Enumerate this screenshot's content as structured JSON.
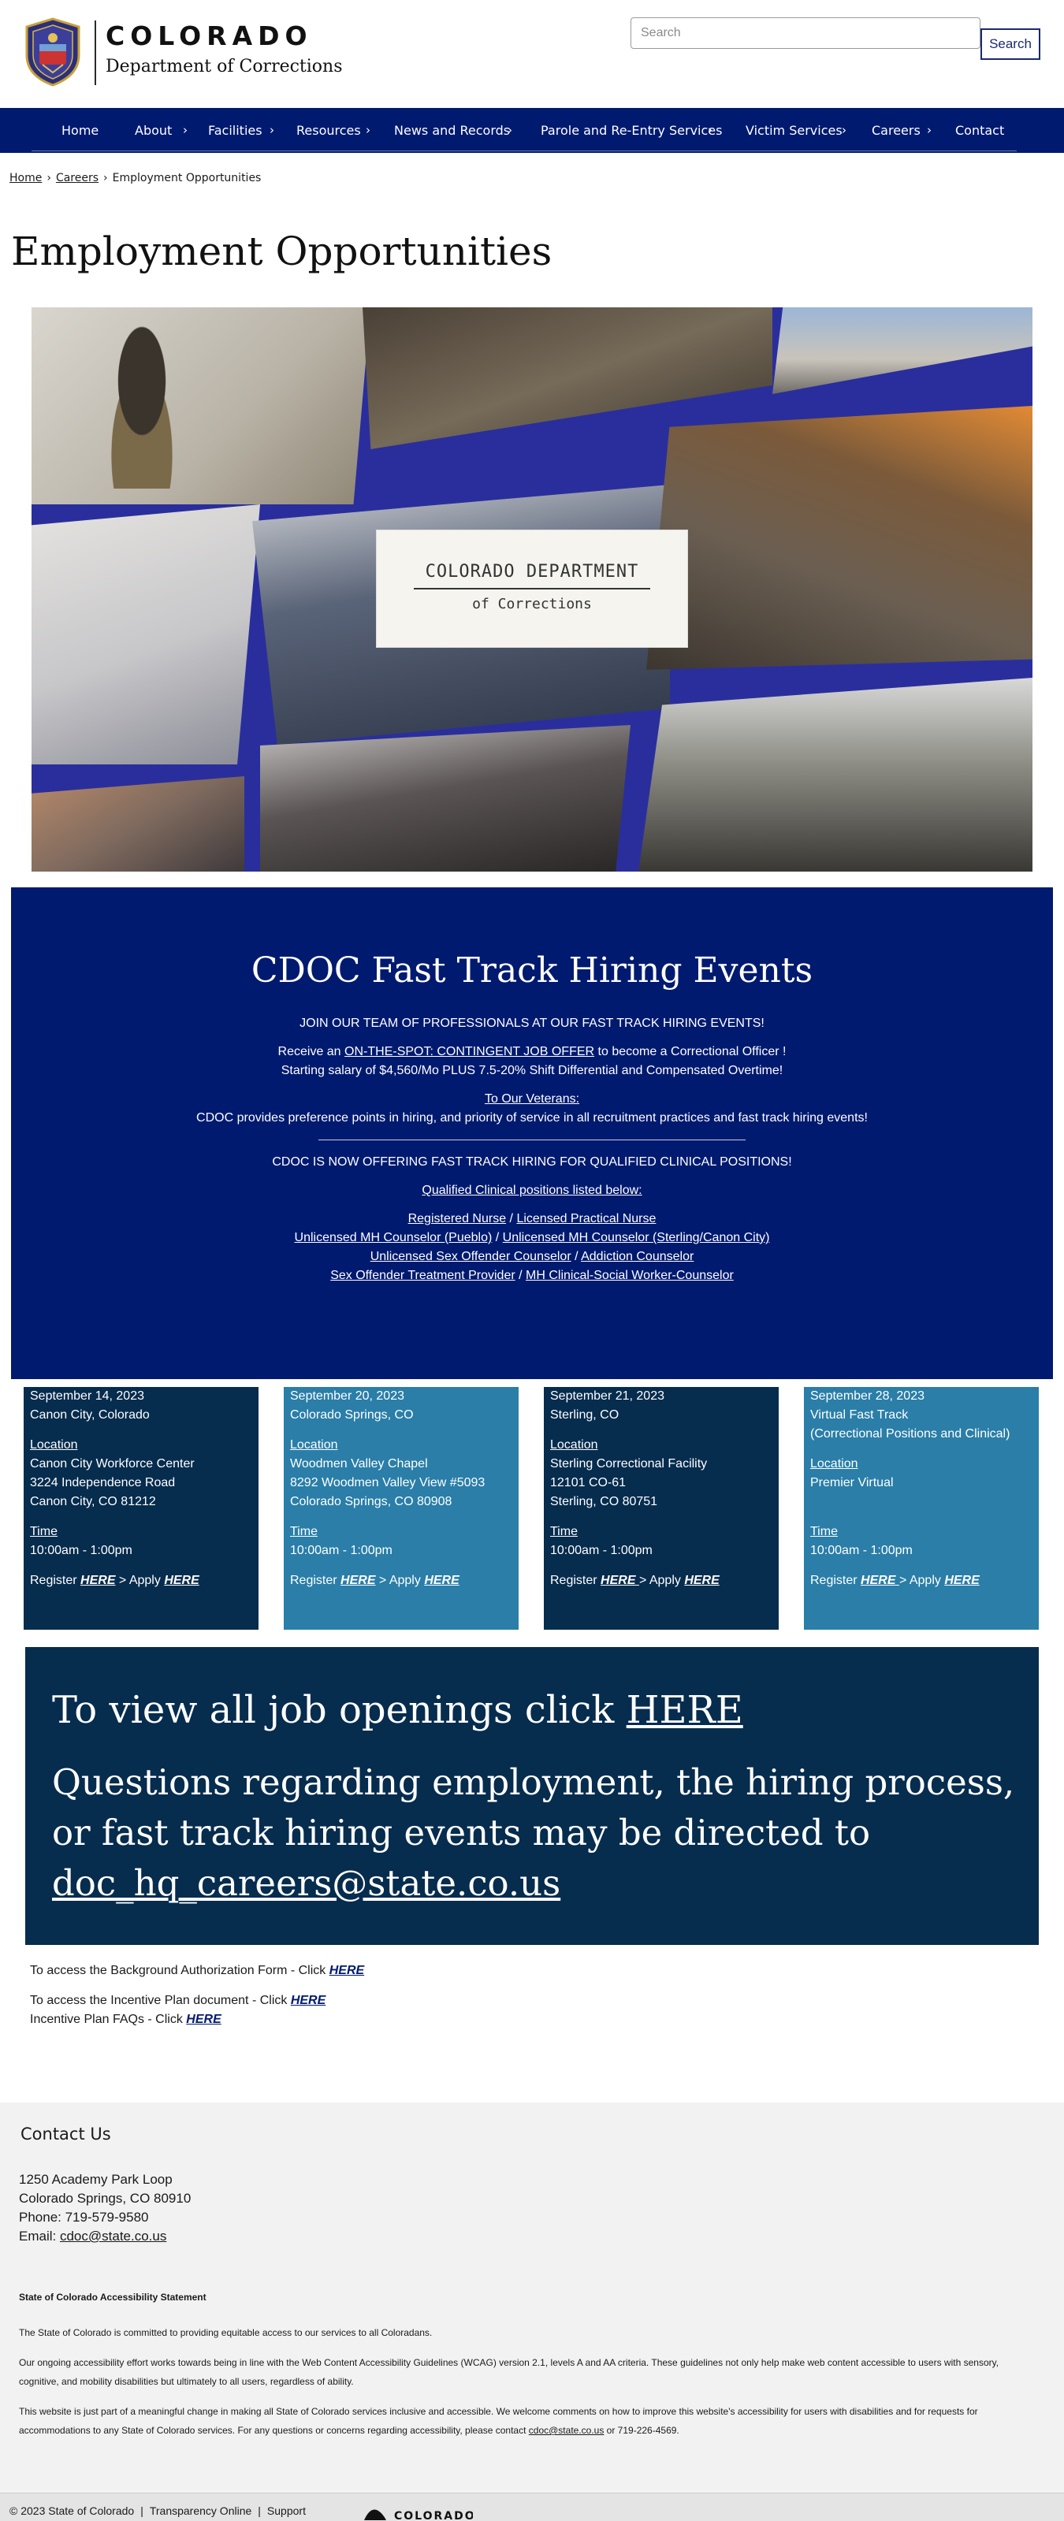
{
  "header": {
    "brand_title": "COLORADO",
    "brand_subtitle": "Department of Corrections",
    "search_placeholder": "Search",
    "search_button": "Search"
  },
  "nav": {
    "items": [
      {
        "label": "Home",
        "has_submenu": false
      },
      {
        "label": "About",
        "has_submenu": true
      },
      {
        "label": "Facilities",
        "has_submenu": true
      },
      {
        "label": "Resources",
        "has_submenu": true
      },
      {
        "label": "News and Records",
        "has_submenu": true
      },
      {
        "label": "Parole and Re-Entry Services",
        "has_submenu": true
      },
      {
        "label": "Victim Services",
        "has_submenu": true
      },
      {
        "label": "Careers",
        "has_submenu": true
      },
      {
        "label": "Contact",
        "has_submenu": false
      }
    ]
  },
  "breadcrumb": {
    "home": "Home",
    "careers": "Careers",
    "current": "Employment Opportunities"
  },
  "page_title": "Employment Opportunities",
  "hero": {
    "card_line1": "COLORADO DEPARTMENT",
    "card_line2": "of Corrections"
  },
  "fast_track": {
    "heading": "CDOC Fast Track Hiring Events",
    "join_line": "JOIN OUR TEAM OF PROFESSIONALS AT OUR FAST TRACK HIRING EVENTS!",
    "offer_prefix": "Receive an ",
    "offer_link": "ON-THE-SPOT: CONTINGENT JOB OFFER",
    "offer_suffix": " to become a Correctional Officer !",
    "salary_line": "Starting salary of $4,560/Mo PLUS 7.5-20% Shift Differential and Compensated Overtime!",
    "veterans_heading": "To Our Veterans:",
    "veterans_text": "CDOC provides preference points in hiring, and priority of service in all recruitment practices and fast track hiring events!",
    "clinical_line": "CDOC IS NOW OFFERING FAST TRACK HIRING FOR QUALIFIED CLINICAL POSITIONS!",
    "clinical_heading": "Qualified Clinical positions listed below:",
    "positions": {
      "rn": "Registered Nurse",
      "lpn": "Licensed Practical Nurse",
      "mh_pueblo": "Unlicensed MH Counselor (Pueblo)",
      "mh_sterling": "Unlicensed MH Counselor (Sterling/Canon City)",
      "sex_offender_counselor": "Unlicensed Sex Offender Counselor",
      "addiction": "Addiction Counselor",
      "sot_provider": "Sex Offender Treatment Provider",
      "mh_clinical_social": "MH Clinical-Social Worker-Counselor"
    },
    "separator": " / "
  },
  "events": [
    {
      "date": "September 14, 2023",
      "city": "Canon City, Colorado",
      "location_label": "Location",
      "location": [
        "Canon City Workforce Center",
        "3224 Independence Road",
        "Canon City, CO 81212"
      ],
      "time_label": "Time",
      "time": "10:00am - 1:00pm",
      "register_text": "Register ",
      "register_link": "HERE",
      "apply_text": " > Apply ",
      "apply_link": "HERE"
    },
    {
      "date": "September 20, 2023",
      "city": "Colorado Springs, CO",
      "location_label": "Location",
      "location": [
        "Woodmen Valley Chapel",
        "8292 Woodmen Valley View #5093",
        "Colorado Springs, CO 80908"
      ],
      "time_label": "Time",
      "time": "10:00am - 1:00pm",
      "register_text": "Register ",
      "register_link": "HERE",
      "apply_text": " > Apply ",
      "apply_link": "HERE"
    },
    {
      "date": "September 21, 2023",
      "city": "Sterling, CO",
      "location_label": "Location",
      "location": [
        "Sterling Correctional Facility",
        "12101 CO-61",
        "Sterling, CO 80751"
      ],
      "time_label": "Time",
      "time": "10:00am - 1:00pm",
      "register_text": "Register ",
      "register_link": "HERE ",
      "apply_text": "> Apply ",
      "apply_link": "HERE"
    },
    {
      "date": "September 28, 2023",
      "city": "Virtual Fast Track",
      "city2": "(Correctional Positions and Clinical)",
      "location_label": "Location",
      "location": [
        "Premier Virtual"
      ],
      "time_label": "Time",
      "time": "10:00am - 1:00pm",
      "register_text": "Register ",
      "register_link": "HERE ",
      "apply_text": "> Apply ",
      "apply_link": "HERE"
    }
  ],
  "callout": {
    "view_prefix": "To view all job openings click ",
    "view_link": "HERE",
    "questions": "Questions regarding employment, the hiring process, or fast track hiring events may be directed to ",
    "email": "doc_hq_careers@state.co.us"
  },
  "documents": {
    "background_text": "To access the Background Authorization Form - Click ",
    "background_link": "HERE",
    "incentive_text": "To access the Incentive Plan document - Click ",
    "incentive_link": "HERE",
    "faq_text": "Incentive Plan FAQs - Click ",
    "faq_link": "HERE"
  },
  "footer": {
    "contact_heading": "Contact Us",
    "address1": "1250 Academy Park Loop",
    "address2": "Colorado Springs, CO 80910",
    "phone": "Phone: 719-579-9580",
    "email_label": "Email: ",
    "email": "cdoc@state.co.us",
    "accessibility_heading": "State of Colorado Accessibility Statement",
    "acc_p1": "The State of Colorado is committed to providing equitable access to our services to all Coloradans.",
    "acc_p2": "Our ongoing accessibility effort works towards being in line with the Web Content Accessibility Guidelines (WCAG) version 2.1, levels A and AA criteria. These guidelines not only help make web content accessible to users with sensory, cognitive, and mobility disabilities but ultimately to all users, regardless of ability.",
    "acc_p3_a": "This website is just part of a meaningful change in making all State of Colorado services inclusive and accessible. We welcome comments on how to improve this website's accessibility for users with disabilities and for requests for accommodations to any State of Colorado services. For any questions or concerns regarding accessibility, please contact ",
    "acc_p3_email": "cdoc@state.co.us",
    "acc_p3_b": " or 719-226-4569.",
    "bottom": {
      "copyright": "© 2023 State of Colorado",
      "transparency": "Transparency Online",
      "support": "Support",
      "logo_text": "COLORADO"
    }
  },
  "colors": {
    "nav_blue": "#001a70",
    "event_dark": "#062c4e",
    "event_light": "#2a7ea8",
    "footer_bg": "#f2f2f2"
  }
}
